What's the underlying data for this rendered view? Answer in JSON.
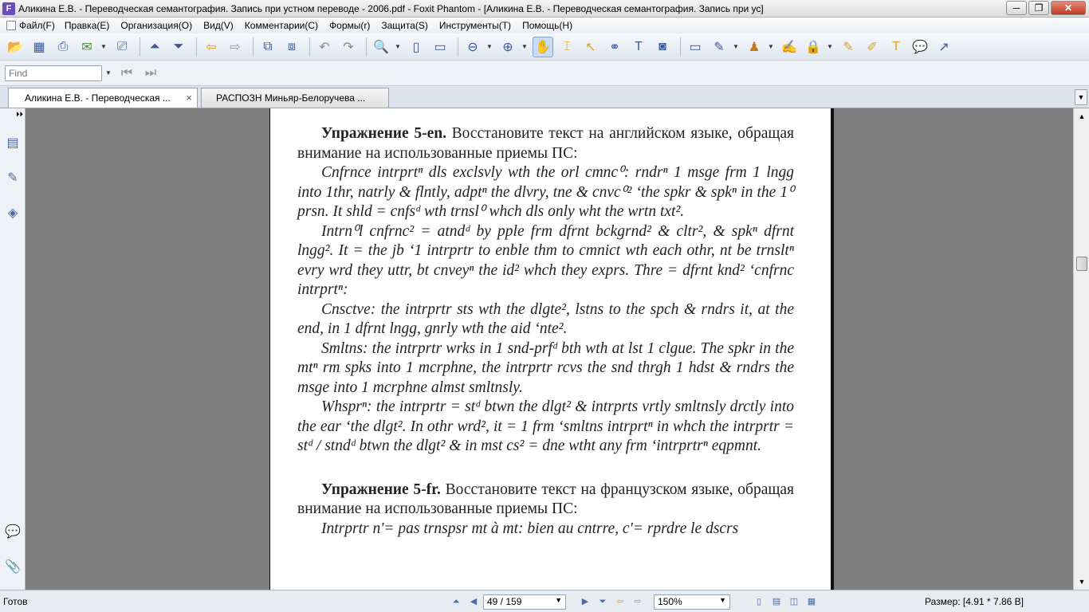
{
  "window": {
    "title": "Аликина Е.В. - Переводческая семантография. Запись при устном переводе - 2006.pdf - Foxit Phantom - [Аликина Е.В. - Переводческая семантография. Запись при ус]",
    "minimize": "─",
    "maximize": "❐",
    "close": "✕"
  },
  "menu": [
    {
      "label": "Файл(F)"
    },
    {
      "label": "Правка(E)"
    },
    {
      "label": "Организация(O)"
    },
    {
      "label": "Вид(V)"
    },
    {
      "label": "Комментарии(C)"
    },
    {
      "label": "Формы(r)"
    },
    {
      "label": "Защита(S)"
    },
    {
      "label": "Инструменты(T)"
    },
    {
      "label": "Помощь(H)"
    }
  ],
  "find": {
    "placeholder": "Find"
  },
  "tabs": [
    {
      "label": "Аликина Е.В. - Переводческая ...",
      "close": "×"
    },
    {
      "label": "РАСПОЗН Миньяр-Белоручева ..."
    }
  ],
  "document": {
    "ex1_heading": "Упражнение 5-en.",
    "ex1_instruction": " Восстановите текст на английском языке, обращая внимание на использованные приемы ПС:",
    "p1": "Cnfrnce intrprtⁿ dls exclsvly wth the orl cmnc⁰: rndrⁿ 1 msge frm 1 lngg into 1thr, natrly & flntly, adptⁿ the dlvry, tne & cnvc⁰² ‘the spkr & spkⁿ in the 1⁰ prsn. It shld = cnfsᵈ wth trnsl⁰ whch dls only wht the wrtn txt².",
    "p2": "Intrn⁰l cnfrnc² = atndᵈ by pple frm dfrnt bckgrnd² & cltr², & spkⁿ dfrnt lngg². It = the jb ‘1 intrprtr to enble thm to cmnict wth each othr, nt be trnsltⁿ evry wrd they uttr, bt cnveyⁿ the id² whch they exprs. Thre = dfrnt knd² ‘cnfrnc intrprtⁿ:",
    "p3": "Cnsctve: the intrprtr sts wth the dlgte², lstns to the spch & rndrs it, at the end, in 1 dfrnt lngg, gnrly wth the aid ‘nte².",
    "p4": "Smltns: the intrprtr wrks in 1 snd-prfᵈ bth wth at lst 1 clgue. The spkr in the mtⁿ rm spks into 1 mcrphne, the intrprtr rcvs the snd thrgh 1 hdst & rndrs the msge into 1 mcrphne almst smltnsly.",
    "p5": "Whsprⁿ: the intrprtr = stᵈ btwn the dlgt² & intrprts vrtly smltnsly drctly into the ear ‘the dlgt². In othr wrd², it = 1 frm ‘smltns intrprtⁿ in whch the intrprtr = stᵈ / stndᵈ btwn the dlgt² & in mst cs² = dne wtht any frm ‘intrprtrⁿ eqpmnt.",
    "ex2_heading": "Упражнение 5-fr.",
    "ex2_instruction": " Восстановите текст на французском языке, обращая внимание на использованные приемы ПС:",
    "p6": "Intrprtr n'= pas trnspsr mt à mt: bien au cntrre, c'= rprdre le dscrs"
  },
  "status": {
    "ready": "Готов",
    "page": "49 / 159",
    "zoom": "150%",
    "size": "Размер: [4.91 * 7.86 В]"
  }
}
